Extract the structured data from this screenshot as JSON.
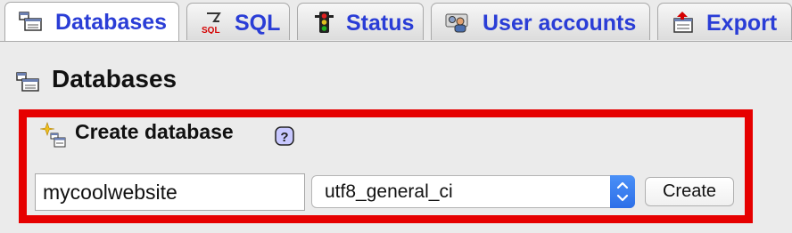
{
  "tabs": [
    {
      "label": "Databases",
      "icon": "database-icon",
      "active": true
    },
    {
      "label": "SQL",
      "icon": "sql-icon",
      "active": false
    },
    {
      "label": "Status",
      "icon": "traffic-light-icon",
      "active": false
    },
    {
      "label": "User accounts",
      "icon": "users-icon",
      "active": false
    },
    {
      "label": "Export",
      "icon": "export-icon",
      "active": false
    }
  ],
  "page": {
    "title": "Databases",
    "icon": "database-icon"
  },
  "create": {
    "title": "Create database",
    "icon": "new-database-icon",
    "help_icon": "help-icon",
    "db_name_value": "mycoolwebsite",
    "collation_value": "utf8_general_ci",
    "create_button": "Create"
  },
  "colors": {
    "tab_text": "#2a3dd6",
    "highlight": "#e60000",
    "background": "#ebebeb"
  }
}
